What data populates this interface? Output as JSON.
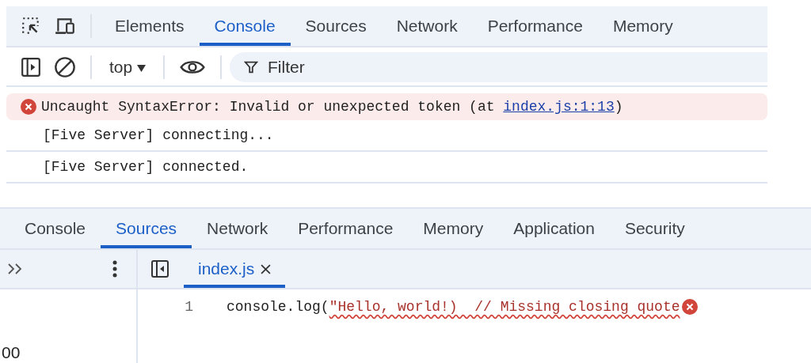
{
  "console_panel": {
    "tabs": [
      {
        "label": "Elements",
        "selected": false
      },
      {
        "label": "Console",
        "selected": true
      },
      {
        "label": "Sources",
        "selected": false
      },
      {
        "label": "Network",
        "selected": false
      },
      {
        "label": "Performance",
        "selected": false
      },
      {
        "label": "Memory",
        "selected": false
      }
    ],
    "toolbar": {
      "context": "top",
      "filter": {
        "placeholder": "Filter"
      }
    },
    "messages": [
      {
        "kind": "error",
        "text": "Uncaught SyntaxError: Invalid or unexpected token (at ",
        "link": "index.js:1:13",
        "suffix": ")"
      },
      {
        "kind": "log",
        "text": "[Five Server] connecting..."
      },
      {
        "kind": "log",
        "text": "[Five Server] connected."
      }
    ]
  },
  "sources_panel": {
    "tabs": [
      {
        "label": "Console",
        "selected": false
      },
      {
        "label": "Sources",
        "selected": true
      },
      {
        "label": "Network",
        "selected": false
      },
      {
        "label": "Performance",
        "selected": false
      },
      {
        "label": "Memory",
        "selected": false
      },
      {
        "label": "Application",
        "selected": false
      },
      {
        "label": "Security",
        "selected": false
      }
    ],
    "navigator": {
      "partial_text": "00"
    },
    "file_tabs": [
      {
        "label": "index.js",
        "selected": true
      }
    ],
    "code_lines": [
      {
        "number": "1",
        "text": "console.log(",
        "error_text": "\"Hello, world!)  // Missing closing quote",
        "error": true
      }
    ]
  }
}
